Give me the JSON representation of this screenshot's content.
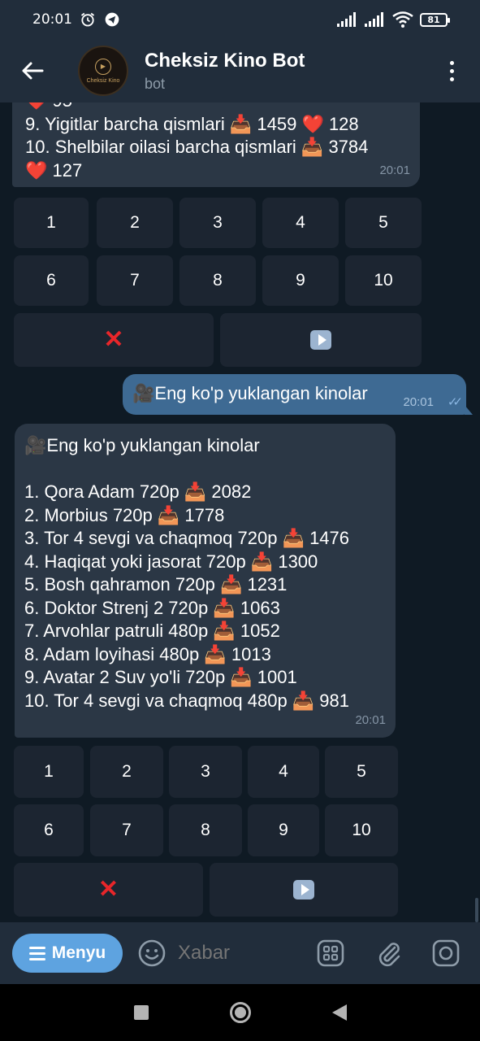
{
  "status_bar": {
    "time": "20:01",
    "battery": "81"
  },
  "header": {
    "title": "Cheksiz Kino Bot",
    "subtitle": "bot",
    "avatar_text": "Cheksiz Kino"
  },
  "messages": {
    "first": {
      "lines": [
        "9. Yigitlar barcha qismlari 📥 1459 ❤️ 128",
        "10. Shelbilar oilasi barcha qismlari 📥 3784",
        "❤️ 127"
      ],
      "time": "20:01"
    },
    "outgoing": {
      "text": "🎥Eng ko'p yuklangan kinolar",
      "time": "20:01"
    },
    "second": {
      "header": "🎥Eng ko'p yuklangan kinolar",
      "lines": [
        "1. Qora Adam 720p 📥 2082",
        "2. Morbius 720p 📥 1778",
        "3. Tor 4 sevgi va chaqmoq 720p 📥 1476",
        "4. Haqiqat yoki jasorat 720p 📥 1300",
        "5. Bosh qahramon 720p 📥 1231",
        "6. Doktor Strenj 2 720p 📥 1063",
        "7. Arvohlar patruli 480p 📥 1052",
        "8. Adam loyihasi 480p 📥 1013",
        "9. Avatar 2 Suv yo'li 720p 📥 1001",
        "10. Tor 4 sevgi va chaqmoq 480p 📥 981"
      ],
      "time": "20:01"
    }
  },
  "keyboard1": {
    "numbers": [
      "1",
      "2",
      "3",
      "4",
      "5",
      "6",
      "7",
      "8",
      "9",
      "10"
    ]
  },
  "keyboard2": {
    "numbers": [
      "1",
      "2",
      "3",
      "4",
      "5",
      "6",
      "7",
      "8",
      "9",
      "10"
    ]
  },
  "input_bar": {
    "menu_label": "Menyu",
    "placeholder": "Xabar"
  },
  "colors": {
    "accent": "#5ea3e0",
    "outgoing_bubble": "#3e6a93",
    "incoming_bubble": "#2b3745",
    "cross": "#e8262a"
  }
}
